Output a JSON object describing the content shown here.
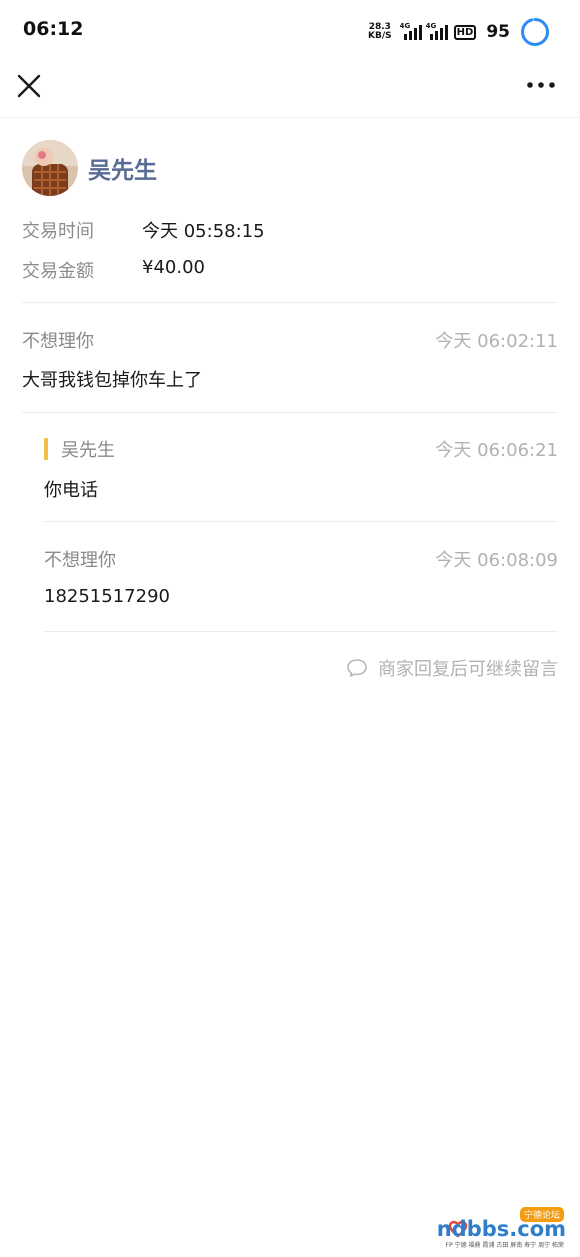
{
  "status_bar": {
    "time": "06:12",
    "net_speed_value": "28.3",
    "net_speed_unit": "KB/S",
    "signal_tag_1": "4G",
    "signal_tag_2": "4G",
    "hd_label": "HD",
    "battery": "95",
    "battery_level": 0.95,
    "ring_color": "#2f8cf2"
  },
  "nav": {
    "close_icon": "close-icon",
    "more_icon": "more-dots-icon"
  },
  "merchant": {
    "name": "吴先生"
  },
  "transaction": {
    "time_label": "交易时间",
    "time_value": "今天 05:58:15",
    "amount_label": "交易金额",
    "amount_value": "¥40.00"
  },
  "messages": [
    {
      "name": "不想理你",
      "time": "今天 06:02:11",
      "text": "大哥我钱包掉你车上了"
    },
    {
      "name": "吴先生",
      "time": "今天 06:06:21",
      "text": "你电话"
    },
    {
      "name": "不想理你",
      "time": "今天 06:08:09",
      "text": "18251517290"
    }
  ],
  "hint": {
    "icon": "comment-icon",
    "text": "商家回复后可继续留言"
  },
  "watermark": {
    "tag": "宁德论坛",
    "main": "ndbbs.com",
    "sub": "FP 宁德 福鼎 霞浦 古田 屏南 寿宁 周宁 柘荣"
  },
  "colors": {
    "name_blue": "#576b95",
    "reply_accent": "#f0c043",
    "muted": "#8c8c8c"
  }
}
